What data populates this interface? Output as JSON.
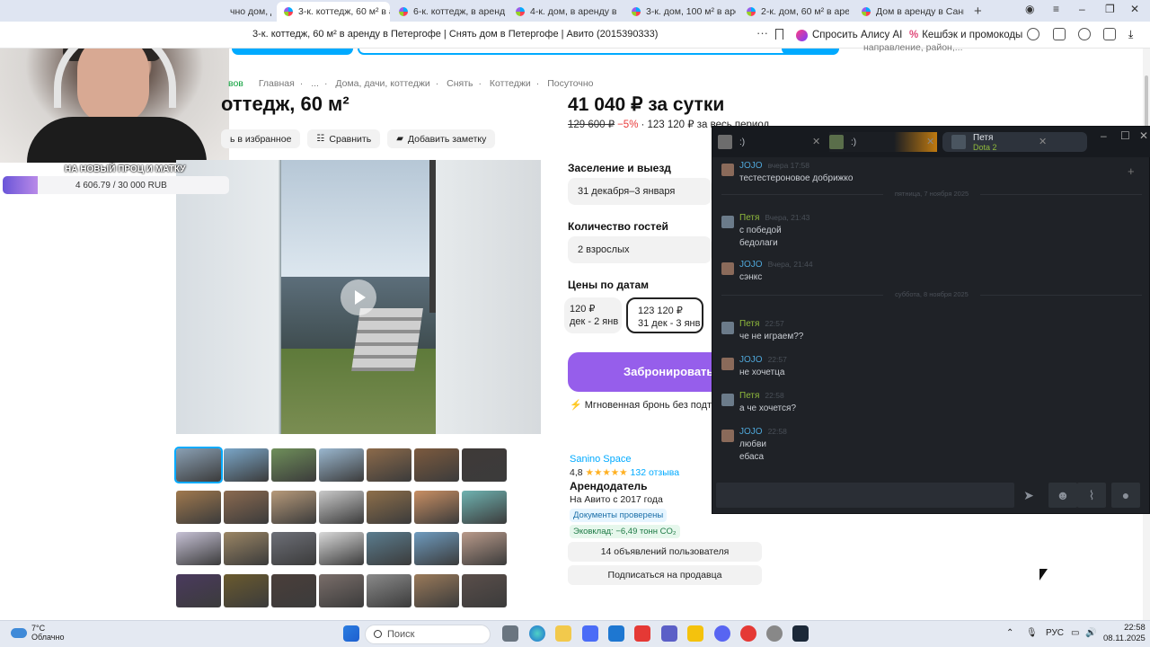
{
  "browser": {
    "tabs": [
      {
        "label": "чно дом, д",
        "active": false
      },
      {
        "label": "3-к. коттедж, 60 м² в а",
        "active": true
      },
      {
        "label": "6-к. коттедж, в аренду п",
        "active": false
      },
      {
        "label": "4-к. дом, в аренду в Пав",
        "active": false
      },
      {
        "label": "3-к. дом, 100 м² в аренд",
        "active": false
      },
      {
        "label": "2-к. дом, 60 м² в аренду",
        "active": false
      },
      {
        "label": "Дом в аренду в Санкт-П",
        "active": false
      }
    ],
    "page_title": "3-к. коттедж, 60 м² в аренду в Петергофе | Снять дом в Петергофе | Авито (2015390333)",
    "alice_label": "Спросить Алису AI",
    "cashback_label": "Кешбэк и промокоды",
    "cashback_icon": "%"
  },
  "search_hint": "направление, район,...",
  "breadcrumbs": [
    "вов",
    "Главная",
    "...",
    "Дома, дачи, коттеджи",
    "Снять",
    "Коттеджи",
    "Посуточно"
  ],
  "listing": {
    "title": "оттедж, 60 м²",
    "actions": {
      "favorite": "ь в избранное",
      "compare": "Сравнить",
      "note": "Добавить заметку"
    },
    "price": "41 040 ₽ за сутки",
    "old_price": "129 600 ₽",
    "discount": "−5%",
    "total": "· 123 120 ₽ за весь период",
    "checkin_label": "Заселение и выезд",
    "checkin_value": "31 декабря–3 января",
    "guests_label": "Количество гостей",
    "guests_value": "2 взрослых",
    "prices_label": "Цены по датам",
    "price_chips": [
      {
        "price": "120 ₽",
        "dates": "дек - 2 янв"
      },
      {
        "price": "123 120 ₽",
        "dates": "31 дек - 3 янв"
      }
    ],
    "book_button": "Забронировать",
    "instant": "Мгновенная бронь без подтве"
  },
  "seller": {
    "name": "Sanino Space",
    "rating": "4,8",
    "stars": "★★★★★",
    "reviews": "132 отзыва",
    "role": "Арендодатель",
    "since": "На Авито с 2017 года",
    "docs": "Документы проверены",
    "eco": "Эковклад: −6,49 тонн CO₂",
    "listings_button": "14 объявлений пользователя",
    "subscribe_button": "Подписаться на продавца"
  },
  "overlay": {
    "donate_title": "НА НОВЫЙ ПРОЦ И МАТКУ",
    "donate_amount": "4 606.79 / 30 000 RUB",
    "donate_progress": 0.154
  },
  "chat": {
    "tabs": [
      {
        "label": ":)"
      },
      {
        "label": ":)"
      },
      {
        "label": "Петя",
        "sub": "Dota 2"
      }
    ],
    "messages": [
      {
        "from": "JOJO",
        "time": "вчера 17:58",
        "lines": [
          "тестестероновое добрижко"
        ]
      },
      {
        "sep": "пятница, 7 ноября 2025"
      },
      {
        "from": "Петя",
        "time": "Вчера, 21:43",
        "lines": [
          "с победой",
          "бедолаги"
        ]
      },
      {
        "from": "JOJO",
        "time": "Вчера, 21:44",
        "lines": [
          "сэнкс"
        ]
      },
      {
        "sep": "суббота, 8 ноября 2025"
      },
      {
        "from": "Петя",
        "time": "22:57",
        "lines": [
          "че не играем??"
        ]
      },
      {
        "from": "JOJO",
        "time": "22:57",
        "lines": [
          "не хочетца"
        ]
      },
      {
        "from": "Петя",
        "time": "22:58",
        "lines": [
          "а че хочется?"
        ]
      },
      {
        "from": "JOJO",
        "time": "22:58",
        "lines": [
          "любви",
          "ебаса"
        ]
      }
    ]
  },
  "taskbar": {
    "temp": "7°C",
    "weather": "Облачно",
    "search": "Поиск",
    "lang": "РУС",
    "time": "22:58",
    "date": "08.11.2025"
  }
}
